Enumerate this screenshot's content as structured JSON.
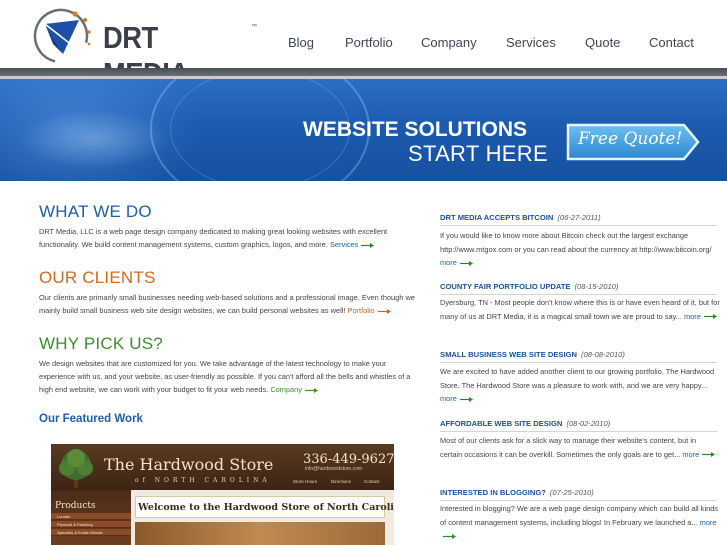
{
  "header": {
    "logo_text": "DRT MEDIA",
    "logo_tm": "™",
    "nav": [
      "Blog",
      "Portfolio",
      "Company",
      "Services",
      "Quote",
      "Contact"
    ]
  },
  "banner": {
    "line1": "WEBSITE SOLUTIONS",
    "line2": "START HERE",
    "button_label": "Free Quote!"
  },
  "sections": {
    "what_we_do": {
      "heading": "WHAT WE DO",
      "color": "#1c5ea8",
      "text": "DRT Media, LLC is a web page design company dedicated to making great looking websites with excellent functionality. We build content management systems, custom graphics, logos, and more.",
      "link": "Services"
    },
    "our_clients": {
      "heading": "OUR CLIENTS",
      "color": "#d2691e",
      "text": "Our clients are primarily small businesses needing web-based solutions and a professional image. Even though we mainly build small business web site design websites, we can build personal websites as well!",
      "link": "Portfolio"
    },
    "why_pick_us": {
      "heading": "WHY PICK US?",
      "color": "#3a8f2a",
      "text": "We design websites that are customized for you. We take advantage of the latest technology to make your experience with us, and your website, as user-friendly as possible. If you can't afford all the bells and whistles of a high end website, we can work with your budget to fit your web needs.",
      "link": "Company"
    },
    "featured_title": "Our Featured Work"
  },
  "featured": {
    "store_name": "The Hardwood Store",
    "store_state": "of NORTH CAROLINA",
    "phone": "336-449-9627",
    "email": "info@hardwoodstore.com",
    "menu": [
      "Store Hours",
      "Directions",
      "Contact"
    ],
    "sidebar_title": "Products",
    "sidebar_items": [
      "Lumber",
      "Plywood & Paneling",
      "Specialty & Exotic Woods"
    ],
    "welcome": "Welcome to the Hardwood Store of North Carolina!"
  },
  "news": [
    {
      "title": "DRT MEDIA ACCEPTS BITCOIN",
      "date": "(06-27-2011)",
      "body": "If you would like to know more about Bitcoin check out the largest exchange http://www.mtgox.com or you can read about the currency at http://www.bitcoin.org/",
      "more": "more"
    },
    {
      "title": "COUNTY FAIR PORTFOLIO UPDATE",
      "date": "(08-15-2010)",
      "body": "Dyersburg, TN - Most people don't know where this is or have even heard of it, but for many of us at DRT Media, it is a magical small town we are proud to say...",
      "more": "more"
    },
    {
      "title": "SMALL BUSINESS WEB SITE DESIGN",
      "date": "(08-08-2010)",
      "body": "We are excited to have added another client to our growing portfolio, The Hardwood Store. The Hardwood Store was a pleasure to work with, and we are very happy...",
      "more": "more"
    },
    {
      "title": "AFFORDABLE WEB SITE DESIGN",
      "date": "(08-02-2010)",
      "body": "Most of our clients ask for a slick way to manage their website's content, but in certain occasions it can be overkill. Sometimes the only goals are to get...",
      "more": "more"
    },
    {
      "title": "INTERESTED IN BLOGGING?",
      "date": "(07-25-2010)",
      "body": "Interested in blogging? We are a web page design company which can build all kinds of content management systems, including blogs! In February we launched a...",
      "more": "more"
    }
  ],
  "colors": {
    "link": "#1a5fb0",
    "arrow": "#2a8a2a",
    "news_title": "#1a4f9c"
  }
}
